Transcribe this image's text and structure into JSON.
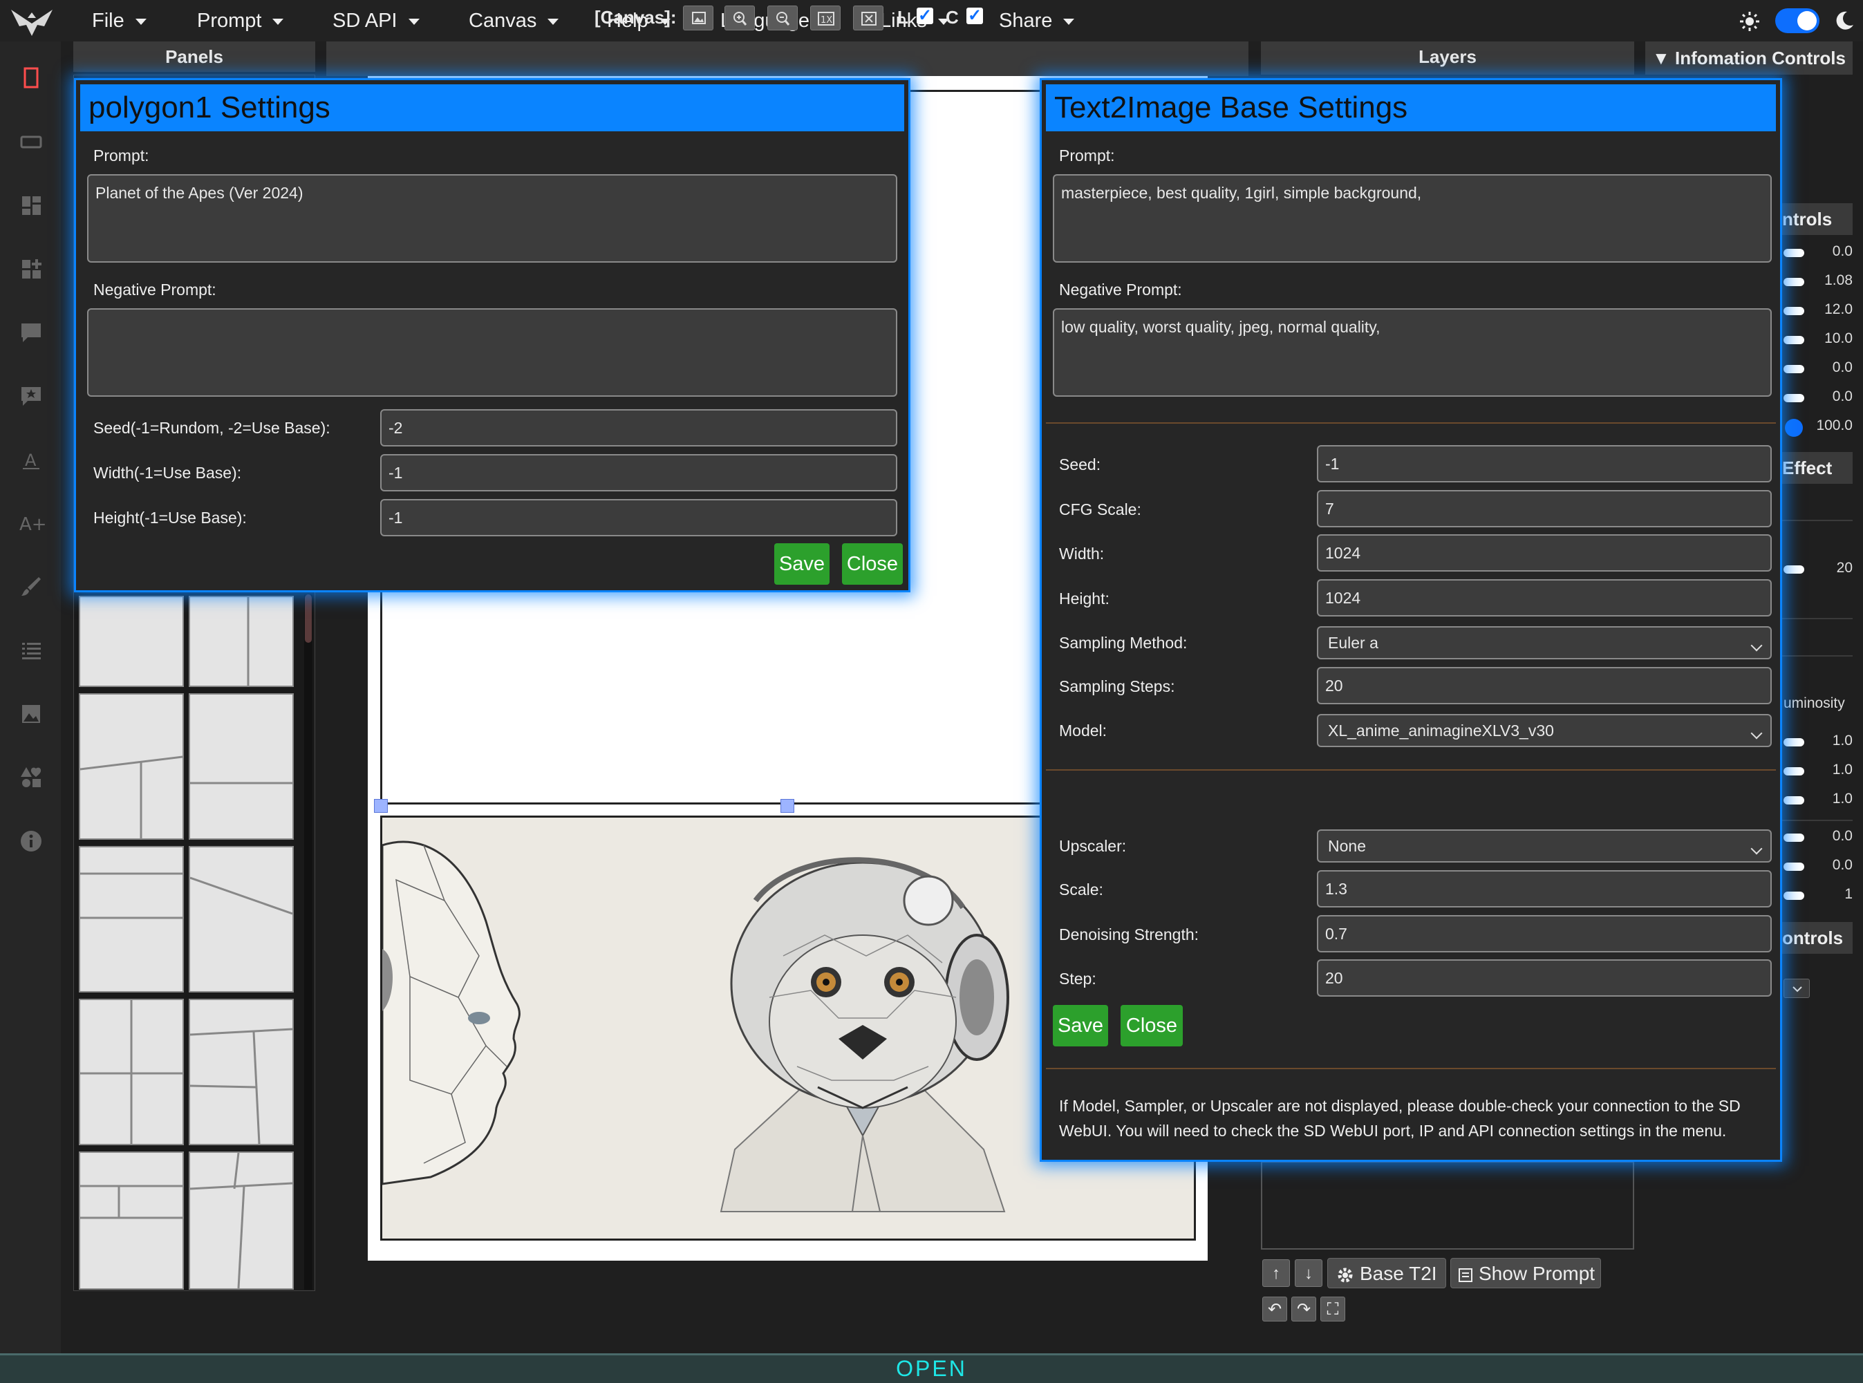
{
  "menu": {
    "items": [
      "File",
      "Prompt",
      "SD API",
      "Canvas",
      "Help",
      "Language",
      "Links",
      "Share"
    ]
  },
  "panels_header": "Panels",
  "canvas_toolbar": {
    "label": "[Canvas]:",
    "l_label": "L",
    "c_label": "C",
    "l_checked": true,
    "c_checked": true
  },
  "layers_header": "Layers",
  "info_header": "▼ Infomation Controls",
  "right_panel": {
    "controls_head_1": "ntrols",
    "values_1": [
      "0.0",
      "1.08",
      "12.0",
      "10.0",
      "0.0",
      "0.0",
      "100.0"
    ],
    "effect_head": "Effect",
    "effect_value": "20",
    "luminosity_label": "uminosity",
    "values_2": [
      "1.0",
      "1.0",
      "1.0",
      "0.0",
      "0.0",
      "1"
    ],
    "controls_head_2": "ontrols"
  },
  "layer_buttons": {
    "base_t2i": "Base T2I",
    "show_prompt": "Show Prompt"
  },
  "polygon_dialog": {
    "title": "polygon1 Settings",
    "prompt_label": "Prompt:",
    "prompt_value": "Planet of the Apes (Ver 2024)",
    "negative_label": "Negative Prompt:",
    "negative_value": "",
    "seed_label": "Seed(-1=Rundom, -2=Use Base):",
    "seed_value": "-2",
    "width_label": "Width(-1=Use Base):",
    "width_value": "-1",
    "height_label": "Height(-1=Use Base):",
    "height_value": "-1",
    "save": "Save",
    "close": "Close"
  },
  "t2i_dialog": {
    "title": "Text2Image Base Settings",
    "prompt_label": "Prompt:",
    "prompt_value": "masterpiece, best quality, 1girl, simple background,",
    "negative_label": "Negative Prompt:",
    "negative_value": "low quality, worst quality, jpeg, normal quality,",
    "seed_label": "Seed:",
    "seed_value": "-1",
    "cfg_label": "CFG Scale:",
    "cfg_value": "7",
    "width_label": "Width:",
    "width_value": "1024",
    "height_label": "Height:",
    "height_value": "1024",
    "sampler_label": "Sampling Method:",
    "sampler_value": "Euler a",
    "steps_label": "Sampling Steps:",
    "steps_value": "20",
    "model_label": "Model:",
    "model_value": "XL_anime_animagineXLV3_v30",
    "upscaler_label": "Upscaler:",
    "upscaler_value": "None",
    "scale_label": "Scale:",
    "scale_value": "1.3",
    "denoise_label": "Denoising Strength:",
    "denoise_value": "0.7",
    "step_label": "Step:",
    "step_value": "20",
    "save": "Save",
    "close": "Close",
    "note": "If Model, Sampler, or Upscaler are not displayed, please double-check your connection to the SD WebUI. You will need to check the SD WebUI port, IP and API connection settings in the menu."
  },
  "status": "OPEN",
  "colors": {
    "accent": "#0a84ff",
    "button_green": "#2ca02c",
    "status_text": "#1ee6e6"
  }
}
